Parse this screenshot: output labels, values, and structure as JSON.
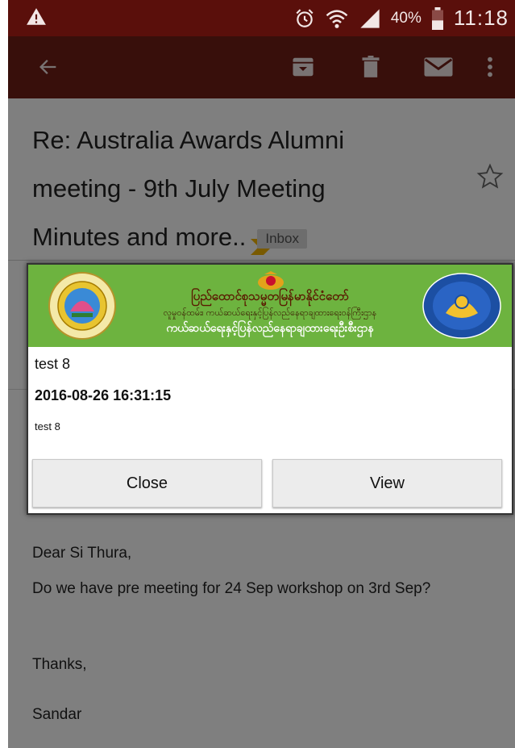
{
  "status_bar": {
    "battery_percent": "40%",
    "time": "11:18"
  },
  "email": {
    "subject_lines": [
      "Re: Australia Awards Alumni",
      "meeting - 9th July Meeting",
      "Minutes and more.."
    ],
    "label": "Inbox",
    "body": {
      "greeting": "Dear Si Thura,",
      "message": "Do we have pre meeting for 24 Sep workshop on 3rd Sep?",
      "closing": "Thanks,",
      "signature": "Sandar"
    }
  },
  "dialog": {
    "banner": {
      "title": "ပြည်ထောင်စုသမ္မတမြန်မာနိုင်ငံတော်",
      "subtitle": "လူမှုဝန်ထမ်း၊ ကယ်ဆယ်ရေးနှင့်ပြန်လည်နေရာချထားရေးဝန်ကြီးဌာန",
      "department": "ကယ်ဆယ်ရေးနှင့်ပြန်လည်နေရာချထားရေးဦးစီးဌာန"
    },
    "title": "test 8",
    "timestamp": "2016-08-26 16:31:15",
    "message": "test 8",
    "close_label": "Close",
    "view_label": "View"
  },
  "colors": {
    "status_bar": "#5a0f0b",
    "toolbar": "#701e16",
    "banner_green": "#6db33f"
  },
  "icons": [
    "warning-icon",
    "alarm-icon",
    "wifi-icon",
    "signal-icon",
    "battery-icon",
    "back-arrow-icon",
    "archive-icon",
    "delete-icon",
    "mail-icon",
    "more-vert-icon",
    "label-chevron-icon",
    "star-icon"
  ]
}
